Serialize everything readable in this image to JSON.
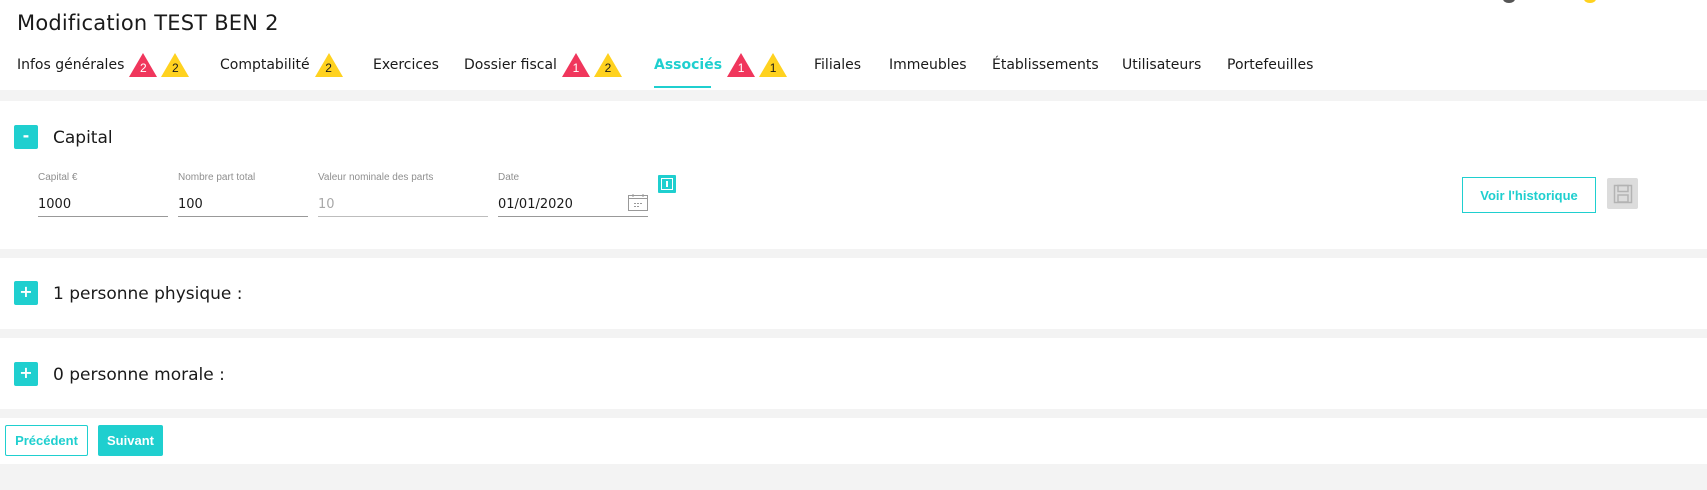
{
  "page": {
    "title": "Modification TEST BEN 2"
  },
  "tabs": [
    {
      "label": "Infos générales",
      "red": "2",
      "yellow": "2"
    },
    {
      "label": "Comptabilité",
      "yellow": "2"
    },
    {
      "label": "Exercices"
    },
    {
      "label": "Dossier fiscal",
      "red": "1",
      "yellow": "2"
    },
    {
      "label": "Associés",
      "red": "1",
      "yellow": "1",
      "active": true
    },
    {
      "label": "Filiales"
    },
    {
      "label": "Immeubles"
    },
    {
      "label": "Établissements"
    },
    {
      "label": "Utilisateurs"
    },
    {
      "label": "Portefeuilles"
    }
  ],
  "capital": {
    "toggle": "-",
    "title": "Capital",
    "fields": {
      "capital": {
        "label": "Capital €",
        "value": "1000"
      },
      "parts": {
        "label": "Nombre part total",
        "value": "100"
      },
      "nominal": {
        "label": "Valeur nominale des parts",
        "value": "10"
      },
      "date": {
        "label": "Date",
        "value": "01/01/2020"
      }
    },
    "history_button": "Voir l'historique",
    "icons": {
      "calendar": "calendar-icon",
      "info": "info-icon",
      "save": "save-icon"
    }
  },
  "physique": {
    "toggle": "+",
    "title": "1 personne physique :"
  },
  "morale": {
    "toggle": "+",
    "title": "0 personne morale :"
  },
  "footer": {
    "prev": "Précédent",
    "next": "Suivant"
  },
  "colors": {
    "accent": "#1fcfcf",
    "badge_red": "#f0365c",
    "badge_yellow": "#ffd21f",
    "background": "#f3f3f3"
  }
}
